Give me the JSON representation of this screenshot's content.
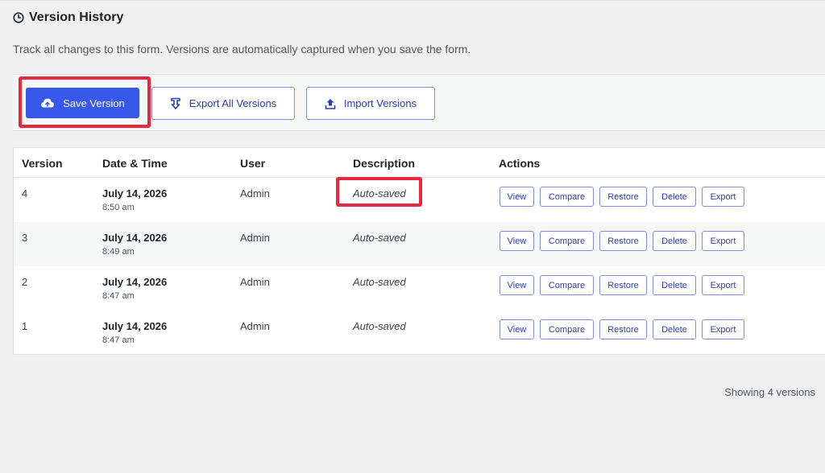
{
  "header": {
    "title": "Version History",
    "icon": "clock-icon"
  },
  "description": "Track all changes to this form. Versions are automatically captured when you save the form.",
  "toolbar": {
    "save_label": "Save Version",
    "save_icon": "cloud-upload-icon",
    "export_all_label": "Export All Versions",
    "export_all_icon": "download-icon",
    "import_label": "Import Versions",
    "import_icon": "upload-icon"
  },
  "colors": {
    "primary": "#3858e9",
    "highlight": "#e8283c",
    "link": "#2c3fa8"
  },
  "table": {
    "columns": [
      "Version",
      "Date & Time",
      "User",
      "Description",
      "Actions"
    ],
    "rows": [
      {
        "version": "4",
        "date": "July 14, 2026",
        "time": "8:50 am",
        "user": "Admin",
        "description": "Auto-saved"
      },
      {
        "version": "3",
        "date": "July 14, 2026",
        "time": "8:49 am",
        "user": "Admin",
        "description": "Auto-saved"
      },
      {
        "version": "2",
        "date": "July 14, 2026",
        "time": "8:47 am",
        "user": "Admin",
        "description": "Auto-saved"
      },
      {
        "version": "1",
        "date": "July 14, 2026",
        "time": "8:47 am",
        "user": "Admin",
        "description": "Auto-saved"
      }
    ],
    "actions": [
      "View",
      "Compare",
      "Restore",
      "Delete",
      "Export"
    ]
  },
  "footer": {
    "count_text": "Showing 4 versions"
  }
}
